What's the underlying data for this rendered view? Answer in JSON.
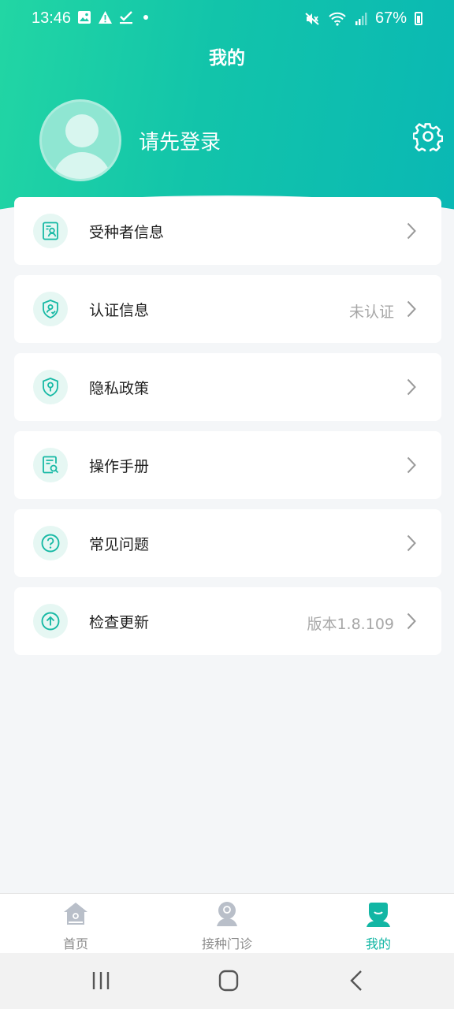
{
  "status_bar": {
    "time": "13:46",
    "battery": "67%",
    "left_icons": [
      "image-icon",
      "warning-icon",
      "check-icon",
      "dot-icon"
    ],
    "right_icons": [
      "mute-icon",
      "wifi-icon",
      "signal-icon",
      "battery-icon"
    ]
  },
  "header": {
    "title": "我的",
    "login_prompt": "请先登录"
  },
  "menu": {
    "items": [
      {
        "label": "受种者信息",
        "value": "",
        "icon": "person-card-icon"
      },
      {
        "label": "认证信息",
        "value": "未认证",
        "icon": "shield-person-icon"
      },
      {
        "label": "隐私政策",
        "value": "",
        "icon": "shield-lock-icon"
      },
      {
        "label": "操作手册",
        "value": "",
        "icon": "document-search-icon"
      },
      {
        "label": "常见问题",
        "value": "",
        "icon": "question-icon"
      },
      {
        "label": "检查更新",
        "value": "版本1.8.109",
        "icon": "arrow-up-circle-icon"
      }
    ]
  },
  "bottom_nav": {
    "items": [
      {
        "label": "首页",
        "active": false
      },
      {
        "label": "接种门诊",
        "active": false
      },
      {
        "label": "我的",
        "active": true
      }
    ]
  },
  "colors": {
    "accent": "#12b6a4",
    "header_start": "#22d6a4",
    "header_end": "#0ab8b4",
    "inactive": "#8c8c8c"
  }
}
